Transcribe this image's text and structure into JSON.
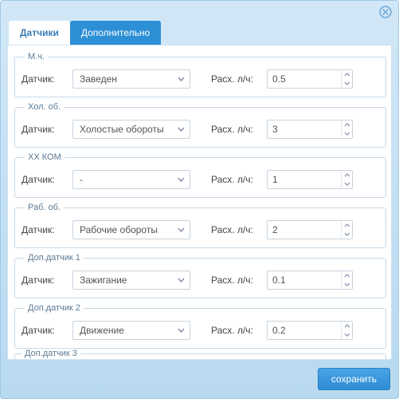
{
  "tabs": {
    "sensors": "Датчики",
    "additional": "Дополнительно"
  },
  "labels": {
    "sensor": "Датчик:",
    "rate": "Расх. л/ч:"
  },
  "groups": [
    {
      "title": "М.ч.",
      "sensor": "Заведен",
      "rate": "0.5"
    },
    {
      "title": "Хол. об.",
      "sensor": "Холостые обороты",
      "rate": "3"
    },
    {
      "title": "ХХ КОМ",
      "sensor": "-",
      "rate": "1"
    },
    {
      "title": "Раб. об.",
      "sensor": "Рабочие обороты",
      "rate": "2"
    },
    {
      "title": "Доп.датчик 1",
      "sensor": "Зажигание",
      "rate": "0.1"
    },
    {
      "title": "Доп.датчик 2",
      "sensor": "Движение",
      "rate": "0.2"
    }
  ],
  "cut_group": {
    "title": "Доп.датчик 3"
  },
  "footer": {
    "save": "сохранить"
  }
}
